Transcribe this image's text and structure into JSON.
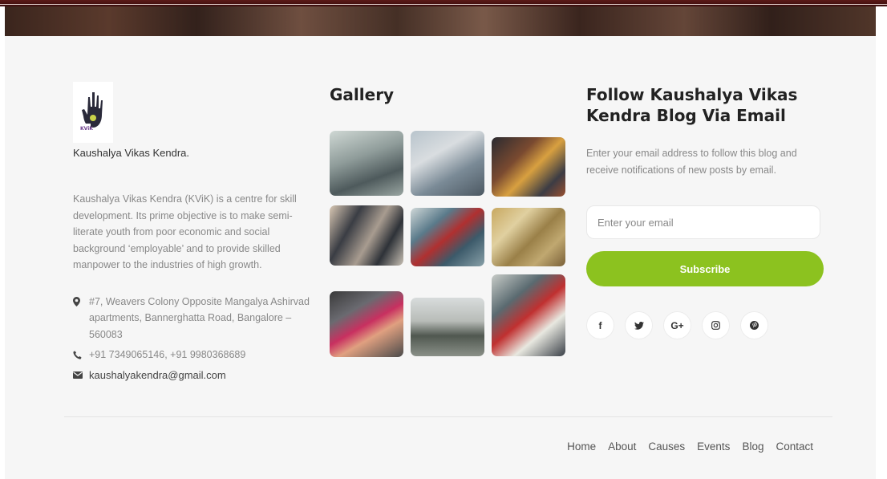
{
  "brand": {
    "name": "Kaushalya Vikas Kendra.",
    "logo_text": "KViK"
  },
  "about": {
    "text": "Kaushalya Vikas Kendra (KViK) is a centre for skill development. Its prime objective is to make semi-literate youth from poor economic and social background ‘employable’ and to provide skilled manpower to the industries of high growth."
  },
  "contact": {
    "address": "#7, Weavers Colony Opposite Mangalya Ashirvad apartments, Bannerghatta Road, Bangalore – 560083",
    "phone": "+91 7349065146, +91 9980368689",
    "email": "kaushalyakendra@gmail.com",
    "icons": [
      "map-marker-icon",
      "phone-icon",
      "envelope-icon"
    ]
  },
  "gallery": {
    "title": "Gallery",
    "image_count": 9
  },
  "follow": {
    "title": "Follow Kaushalya Vikas Kendra Blog Via Email",
    "description": "Enter your email address to follow this blog and receive notifications of new posts by email.",
    "placeholder": "Enter your email",
    "button": "Subscribe",
    "button_color": "#8cc21f"
  },
  "social": [
    {
      "name": "facebook-icon",
      "glyph": "f"
    },
    {
      "name": "twitter-icon",
      "glyph": "🐦"
    },
    {
      "name": "google-plus-icon",
      "glyph": "G+"
    },
    {
      "name": "instagram-icon",
      "glyph": "◎"
    },
    {
      "name": "pinterest-icon",
      "glyph": "℗"
    }
  ],
  "nav": [
    "Home",
    "About",
    "Causes",
    "Events",
    "Blog",
    "Contact"
  ]
}
